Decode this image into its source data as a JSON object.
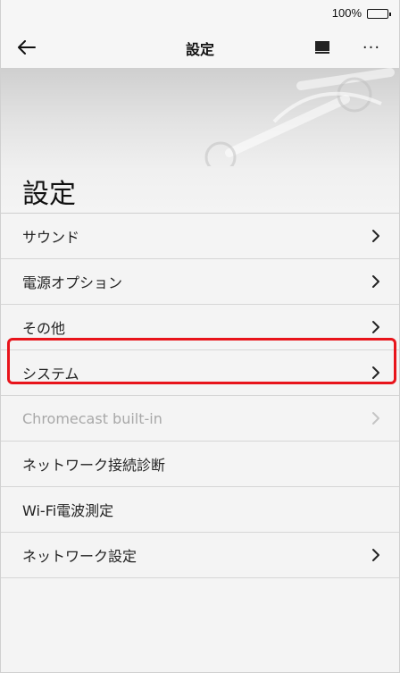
{
  "status_bar": {
    "battery_text": "100%"
  },
  "toolbar": {
    "title": "設定"
  },
  "header": {
    "title": "設定"
  },
  "menu": [
    {
      "label": "サウンド",
      "chevron": true,
      "disabled": false
    },
    {
      "label": "電源オプション",
      "chevron": true,
      "disabled": false
    },
    {
      "label": "その他",
      "chevron": true,
      "disabled": false
    },
    {
      "label": "システム",
      "chevron": true,
      "disabled": false
    },
    {
      "label": "Chromecast built-in",
      "chevron": true,
      "disabled": true
    },
    {
      "label": "ネットワーク接続診断",
      "chevron": false,
      "disabled": false
    },
    {
      "label": "Wi-Fi電波測定",
      "chevron": false,
      "disabled": false
    },
    {
      "label": "ネットワーク設定",
      "chevron": true,
      "disabled": false
    }
  ],
  "icons": {
    "back": "arrow-left-icon",
    "cast": "display-icon",
    "more": "more-horizontal-icon",
    "chevron": "chevron-right-icon"
  },
  "colors": {
    "highlight": "#e8141b",
    "disabled_text": "#a8a8a8"
  }
}
